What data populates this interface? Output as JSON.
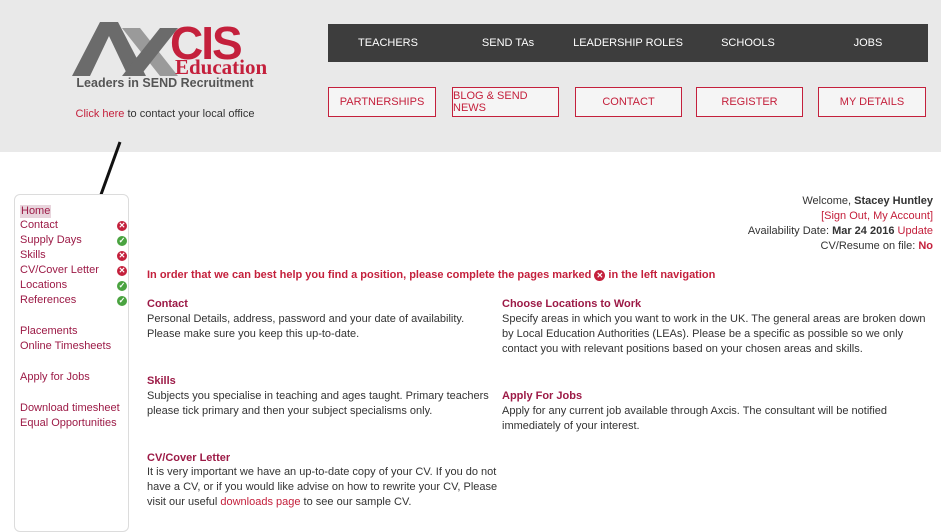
{
  "logo": {
    "mark": "A",
    "name": "CIS",
    "sub": "Education",
    "tagline": "Leaders in SEND Recruitment"
  },
  "contact_prompt": {
    "link": "Click here",
    "text": " to contact your local office"
  },
  "nav_primary": [
    "TEACHERS",
    "SEND TAs",
    "LEADERSHIP ROLES",
    "SCHOOLS",
    "JOBS"
  ],
  "nav_secondary": [
    "PARTNERSHIPS",
    "BLOG & SEND NEWS",
    "CONTACT",
    "REGISTER",
    "MY DETAILS"
  ],
  "sidebar": {
    "home": "Home",
    "items": [
      {
        "label": "Contact",
        "status": "incomplete"
      },
      {
        "label": "Supply Days",
        "status": "complete"
      },
      {
        "label": "Skills",
        "status": "incomplete"
      },
      {
        "label": "CV/Cover Letter",
        "status": "incomplete"
      },
      {
        "label": "Locations",
        "status": "complete"
      },
      {
        "label": "References",
        "status": "complete"
      }
    ],
    "links": [
      "Placements",
      "Online Timesheets",
      "Apply for Jobs",
      "Download timesheet",
      "Equal Opportunities"
    ]
  },
  "welcome": {
    "greeting": "Welcome, ",
    "user": "Stacey Huntley",
    "sign_out": "Sign Out",
    "sep": ", ",
    "my_account": "My Account",
    "availability_label": "Availability Date: ",
    "availability_date": "Mar 24 2016",
    "update": "Update",
    "cv_label": "CV/Resume on file: ",
    "cv_value": "No"
  },
  "notice": {
    "before": "In order that we can best help you find a position, please complete the pages marked",
    "after": "in the left navigation"
  },
  "sections": {
    "contact": {
      "title": "Contact",
      "body": "Personal Details, address, password and your date of availability. Please make sure you keep this up-to-date."
    },
    "skills": {
      "title": "Skills",
      "body": "Subjects you specialise in teaching and ages taught. Primary teachers please tick primary and then your subject specialisms only."
    },
    "cv": {
      "title": "CV/Cover Letter",
      "body": "It is very important we have an up-to-date copy of your CV. If you do not have a CV, or if you would like advise on how to rewrite your CV, Please visit our useful ",
      "link": "downloads page",
      "tail": " to see our sample CV."
    },
    "locations": {
      "title": "Choose Locations to Work",
      "body": "Specify areas in which you want to work in the UK. The general areas are broken down by Local Education Authorities (LEAs). Please be a specific as possible so we only contact you with relevant positions based on your chosen areas and skills."
    },
    "apply": {
      "title": "Apply For Jobs",
      "body": "Apply for any current job available through Axcis. The consultant will be notified immediately of your interest."
    }
  },
  "colors": {
    "brand": "#c4203c",
    "nav_dark": "#3d3d3d",
    "ok": "#4aa340"
  }
}
